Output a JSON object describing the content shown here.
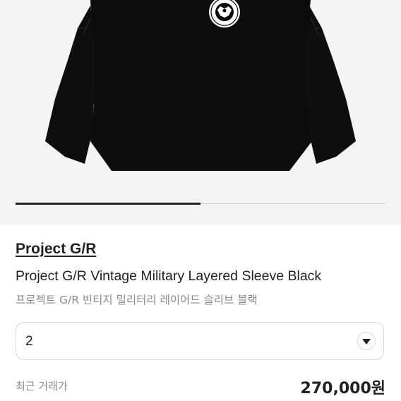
{
  "product": {
    "brand": "Project G/R",
    "name_en": "Project G/R Vintage Military Layered Sleeve Black",
    "name_ko": "프로젝트 G/R 빈티지 밀리터리 레이어드 슬리브 블랙",
    "image_icon": "black-sweatshirt-with-seal-emblem"
  },
  "gallery": {
    "progress": 0.5
  },
  "size_select": {
    "value": "2",
    "icon": "chevron-down-icon"
  },
  "recent_trade": {
    "label": "최근 거래가",
    "price": "270,000원"
  },
  "colors": {
    "image_bg": "#f4f4f4",
    "garment": "#0c0c0c",
    "text_primary": "#222222",
    "text_secondary": "#8a8a8a"
  }
}
